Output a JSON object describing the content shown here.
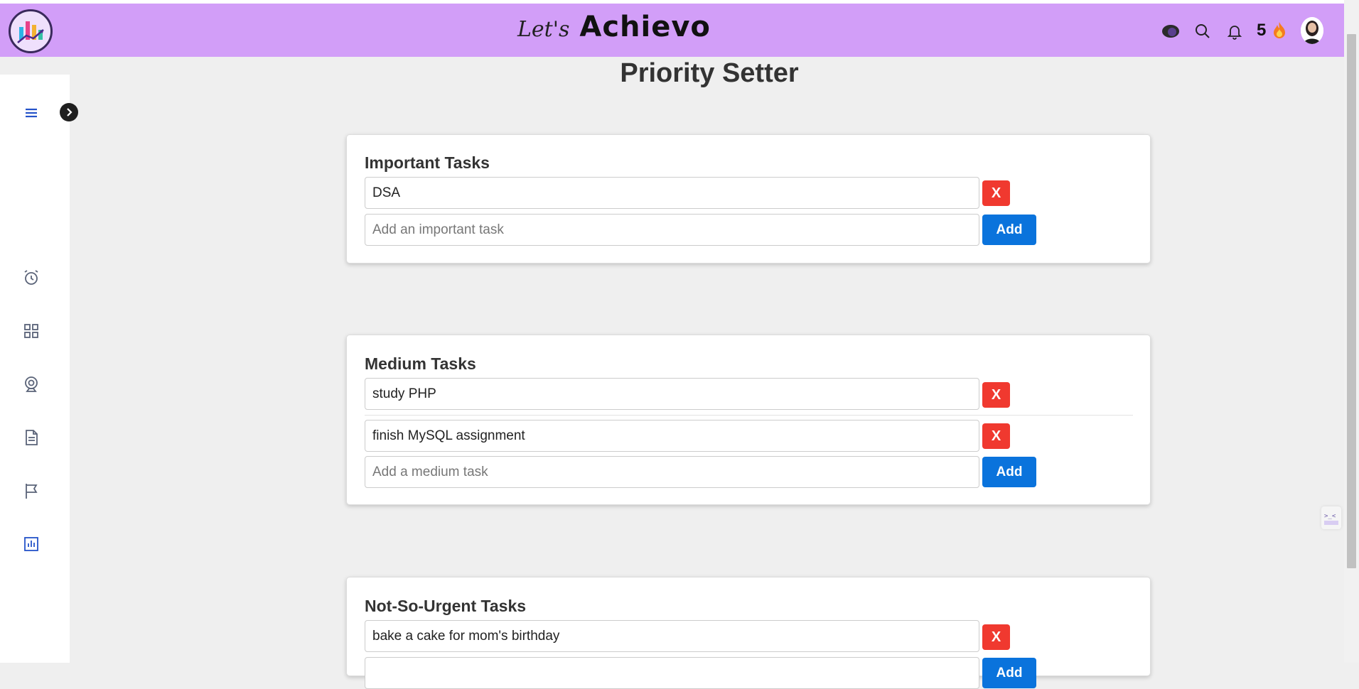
{
  "header": {
    "brand_prefix": "Let's",
    "brand_name": "Achievo",
    "streak_count": "5",
    "icons": [
      "logo-chart-icon",
      "theme-toggle-icon",
      "search-icon",
      "bell-icon",
      "fire-icon",
      "avatar"
    ]
  },
  "sidebar": {
    "icons": [
      "menu-icon",
      "alarm-clock-icon",
      "grid-icon",
      "webcam-icon",
      "document-icon",
      "flag-icon",
      "bar-chart-icon"
    ],
    "active_color": "#2553c9",
    "inactive_color": "#5a6378"
  },
  "page": {
    "title": "Priority Setter"
  },
  "sections": [
    {
      "title": "Important Tasks",
      "tasks": [
        "DSA"
      ],
      "placeholder": "Add an important task",
      "add_label": "Add",
      "delete_label": "X"
    },
    {
      "title": "Medium Tasks",
      "tasks": [
        "study PHP",
        "finish MySQL assignment"
      ],
      "placeholder": "Add a medium task",
      "add_label": "Add",
      "delete_label": "X"
    },
    {
      "title": "Not-So-Urgent Tasks",
      "tasks": [
        "bake a cake for mom's birthday"
      ],
      "placeholder": "",
      "add_label": "Add",
      "delete_label": "X"
    }
  ],
  "colors": {
    "header_bg": "#d29ef8",
    "delete_button": "#f0392f",
    "add_button": "#0a73dc",
    "page_bg": "#efefef"
  }
}
